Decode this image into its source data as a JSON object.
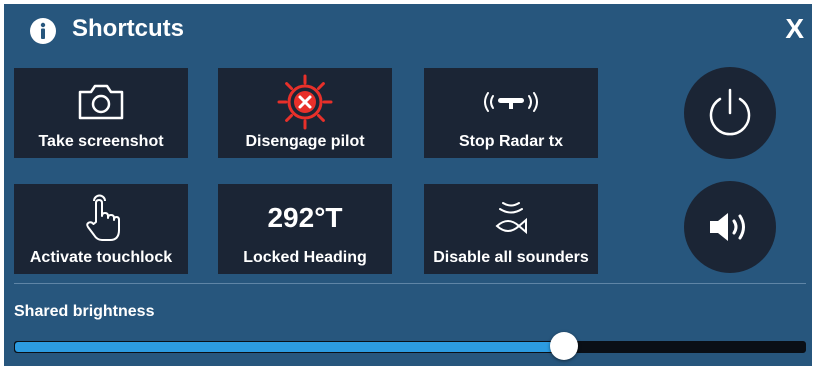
{
  "header": {
    "title": "Shortcuts",
    "close_label": "X"
  },
  "tiles": [
    {
      "label": "Take screenshot",
      "icon": "camera-icon"
    },
    {
      "label": "Disengage pilot",
      "icon": "helm-disengage-icon"
    },
    {
      "label": "Stop Radar tx",
      "icon": "radar-transmit-icon"
    },
    {
      "label": "Activate touchlock",
      "icon": "touch-hand-icon"
    },
    {
      "label": "Locked Heading",
      "value": "292°T"
    },
    {
      "label": "Disable all sounders",
      "icon": "sounder-fish-icon"
    }
  ],
  "round_buttons": [
    {
      "icon": "power-icon"
    },
    {
      "icon": "volume-icon"
    }
  ],
  "brightness": {
    "label": "Shared brightness",
    "value_fraction": 0.695
  },
  "colors": {
    "panel": "#27567d",
    "tile": "#1b2535",
    "accent": "#2c9be0",
    "alert": "#e8302a"
  }
}
